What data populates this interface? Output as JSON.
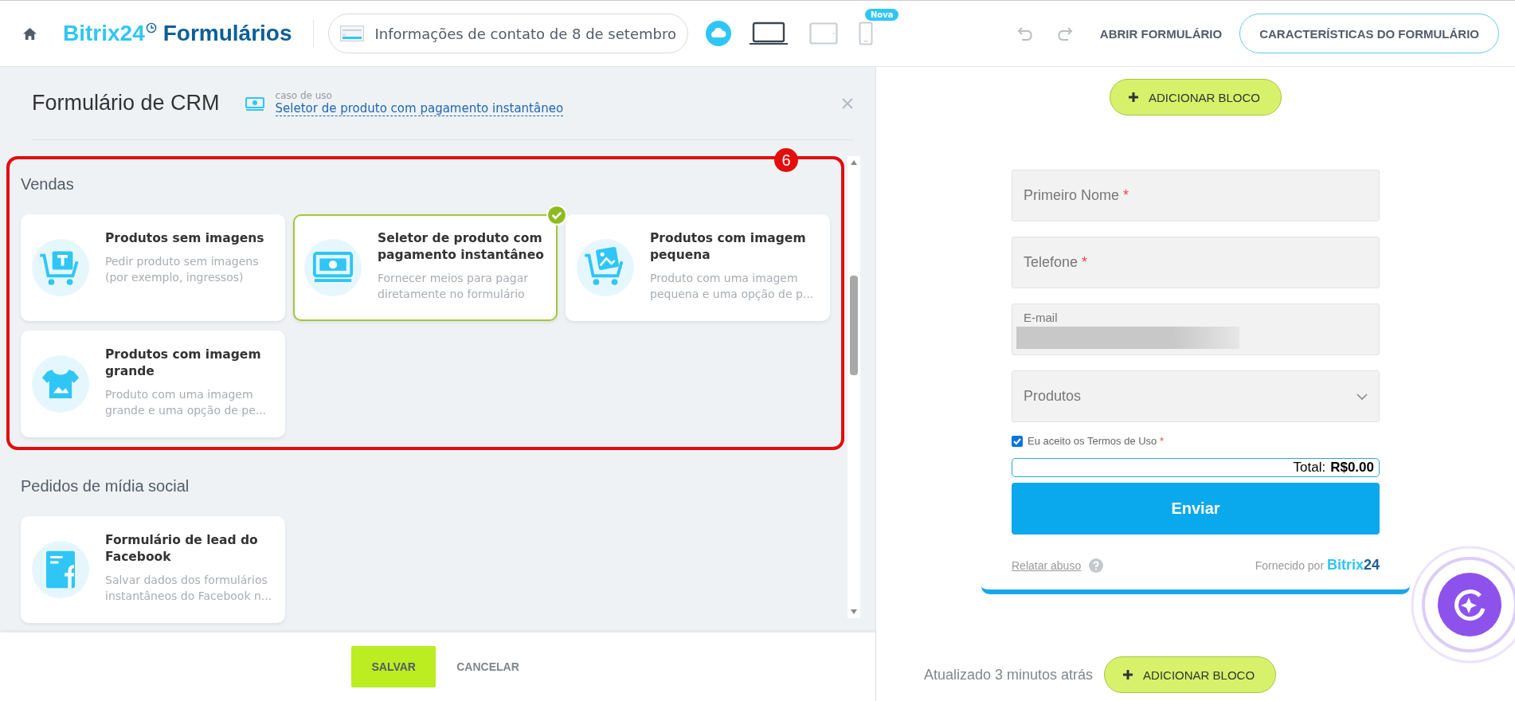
{
  "header": {
    "logo_brand": "Bitrix24",
    "logo_product": "Formulários",
    "form_name": "Informações de contato de 8 de setembro",
    "devices": [
      {
        "kind": "desktop",
        "selected": true
      },
      {
        "kind": "tablet",
        "selected": false
      },
      {
        "kind": "mobile",
        "selected": false,
        "badge": "Nova"
      }
    ],
    "open_form": "ABRIR FORMULÁRIO",
    "settings": "CARACTERÍSTICAS DO FORMULÁRIO"
  },
  "panel": {
    "title": "Formulário de CRM",
    "use_case_label": "caso de uso",
    "use_case_link": "Seletor de produto com pagamento instantâneo",
    "sections": [
      {
        "title": "Vendas",
        "highlighted": true,
        "badge": "6",
        "cards": [
          {
            "kind": "cart-tag",
            "title": "Produtos sem imagens",
            "description": "Pedir produto sem imagens (por exemplo, ingressos)",
            "selected": false
          },
          {
            "kind": "money",
            "title": "Seletor de produto com pagamento instantâneo",
            "description": "Fornecer meios para pagar diretamente no formulário",
            "selected": true
          },
          {
            "kind": "cart-image",
            "title": "Produtos com imagem pequena",
            "description": "Produto com uma imagem pequena e uma opção de p...",
            "selected": false
          },
          {
            "kind": "tshirt",
            "title": "Produtos com imagem grande",
            "description": "Produto com uma imagem grande e uma opção de pe...",
            "selected": false
          }
        ]
      },
      {
        "title": "Pedidos de mídia social",
        "highlighted": false,
        "cards": [
          {
            "kind": "facebook-form",
            "title": "Formulário de lead do Facebook",
            "description": "Salvar dados dos formulários instantâneos do Facebook n...",
            "selected": false
          }
        ]
      }
    ],
    "save": "SALVAR",
    "cancel": "CANCELAR"
  },
  "preview": {
    "add_block": "ADICIONAR BLOCO",
    "fields": [
      {
        "kind": "text",
        "label": "Primeiro Nome",
        "required_mark": "*"
      },
      {
        "kind": "text",
        "label": "Telefone",
        "required_mark": "*"
      },
      {
        "kind": "filled",
        "label": "E-mail"
      },
      {
        "kind": "select",
        "label": "Produtos"
      }
    ],
    "consent": {
      "label": "Eu aceito os Termos de Uso",
      "required_mark": "*",
      "checked": true
    },
    "total_label": "Total:",
    "total_value": "R$0.00",
    "submit": "Enviar",
    "report": "Relatar abuso",
    "powered_by": "Fornecido por",
    "powered_brand": "Bitrix",
    "powered_brand_num": "24"
  },
  "updated": "Atualizado 3 minutos atrás",
  "add_block_bottom": "ADICIONAR BLOCO"
}
